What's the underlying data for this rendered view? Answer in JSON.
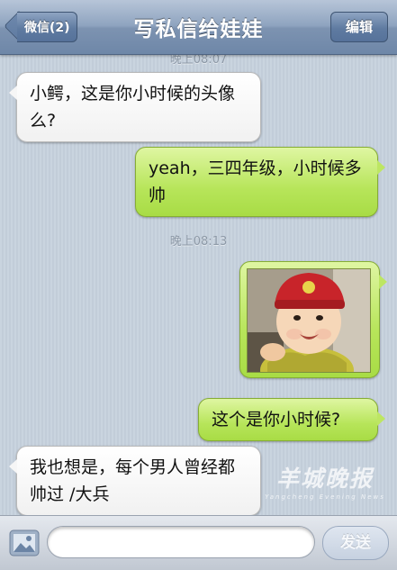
{
  "navbar": {
    "back_label": "微信(2)",
    "title": "写私信给娃娃",
    "edit_label": "编辑"
  },
  "chat": {
    "timestamps": [
      "晚上08:07",
      "晚上08:13"
    ],
    "messages": [
      {
        "direction": "incoming",
        "type": "text",
        "text": "小鳄，这是你小时候的头像么?"
      },
      {
        "direction": "outgoing",
        "type": "text",
        "text": "yeah，三四年级，小时候多帅"
      },
      {
        "direction": "outgoing",
        "type": "image",
        "icon": "baby-photo"
      },
      {
        "direction": "outgoing",
        "type": "text",
        "text": "这个是你小时候?"
      },
      {
        "direction": "incoming",
        "type": "text",
        "text": "我也想是，每个男人曾经都帅过 /大兵"
      }
    ]
  },
  "watermark": {
    "main": "羊城晚报",
    "sub": "Yangcheng Evening News"
  },
  "input_bar": {
    "media_icon": "image-icon",
    "placeholder": "",
    "send_label": "发送"
  },
  "colors": {
    "outgoing_bubble": "#b7e55a",
    "incoming_bubble": "#ffffff",
    "navbar": "#7d93b1",
    "background": "#c6d1dd"
  }
}
